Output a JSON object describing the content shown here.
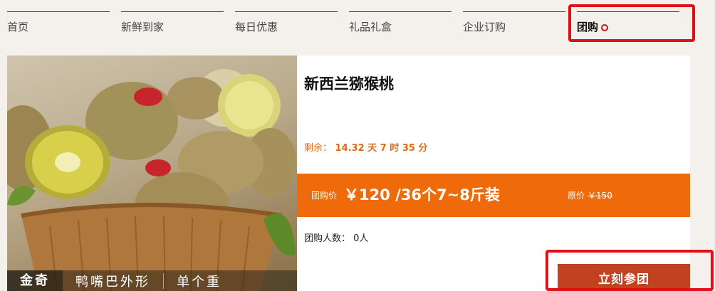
{
  "nav": {
    "items": [
      {
        "label": "首页"
      },
      {
        "label": "新鲜到家"
      },
      {
        "label": "每日优惠"
      },
      {
        "label": "礼品礼盒"
      },
      {
        "label": "企业订购"
      },
      {
        "label": "团购",
        "active": true
      }
    ]
  },
  "product": {
    "title": "新西兰猕猴桃",
    "image_captions": [
      "金奇",
      "鸭嘴巴外形",
      "单个重"
    ]
  },
  "countdown": {
    "label": "剩余：",
    "value": "14.32 天 7 时 35 分"
  },
  "price": {
    "group_label": "团购价",
    "group_value": "￥120 /36个7~8斤装",
    "original_label": "原价",
    "original_value": "￥150"
  },
  "participants": {
    "label": "团购人数：",
    "value": "0人"
  },
  "join_button": "立刻参团",
  "colors": {
    "price_bar": "#ee6a0a",
    "join_button": "#c0421f",
    "countdown_text": "#d96b1a",
    "highlight": "#e0101a"
  }
}
